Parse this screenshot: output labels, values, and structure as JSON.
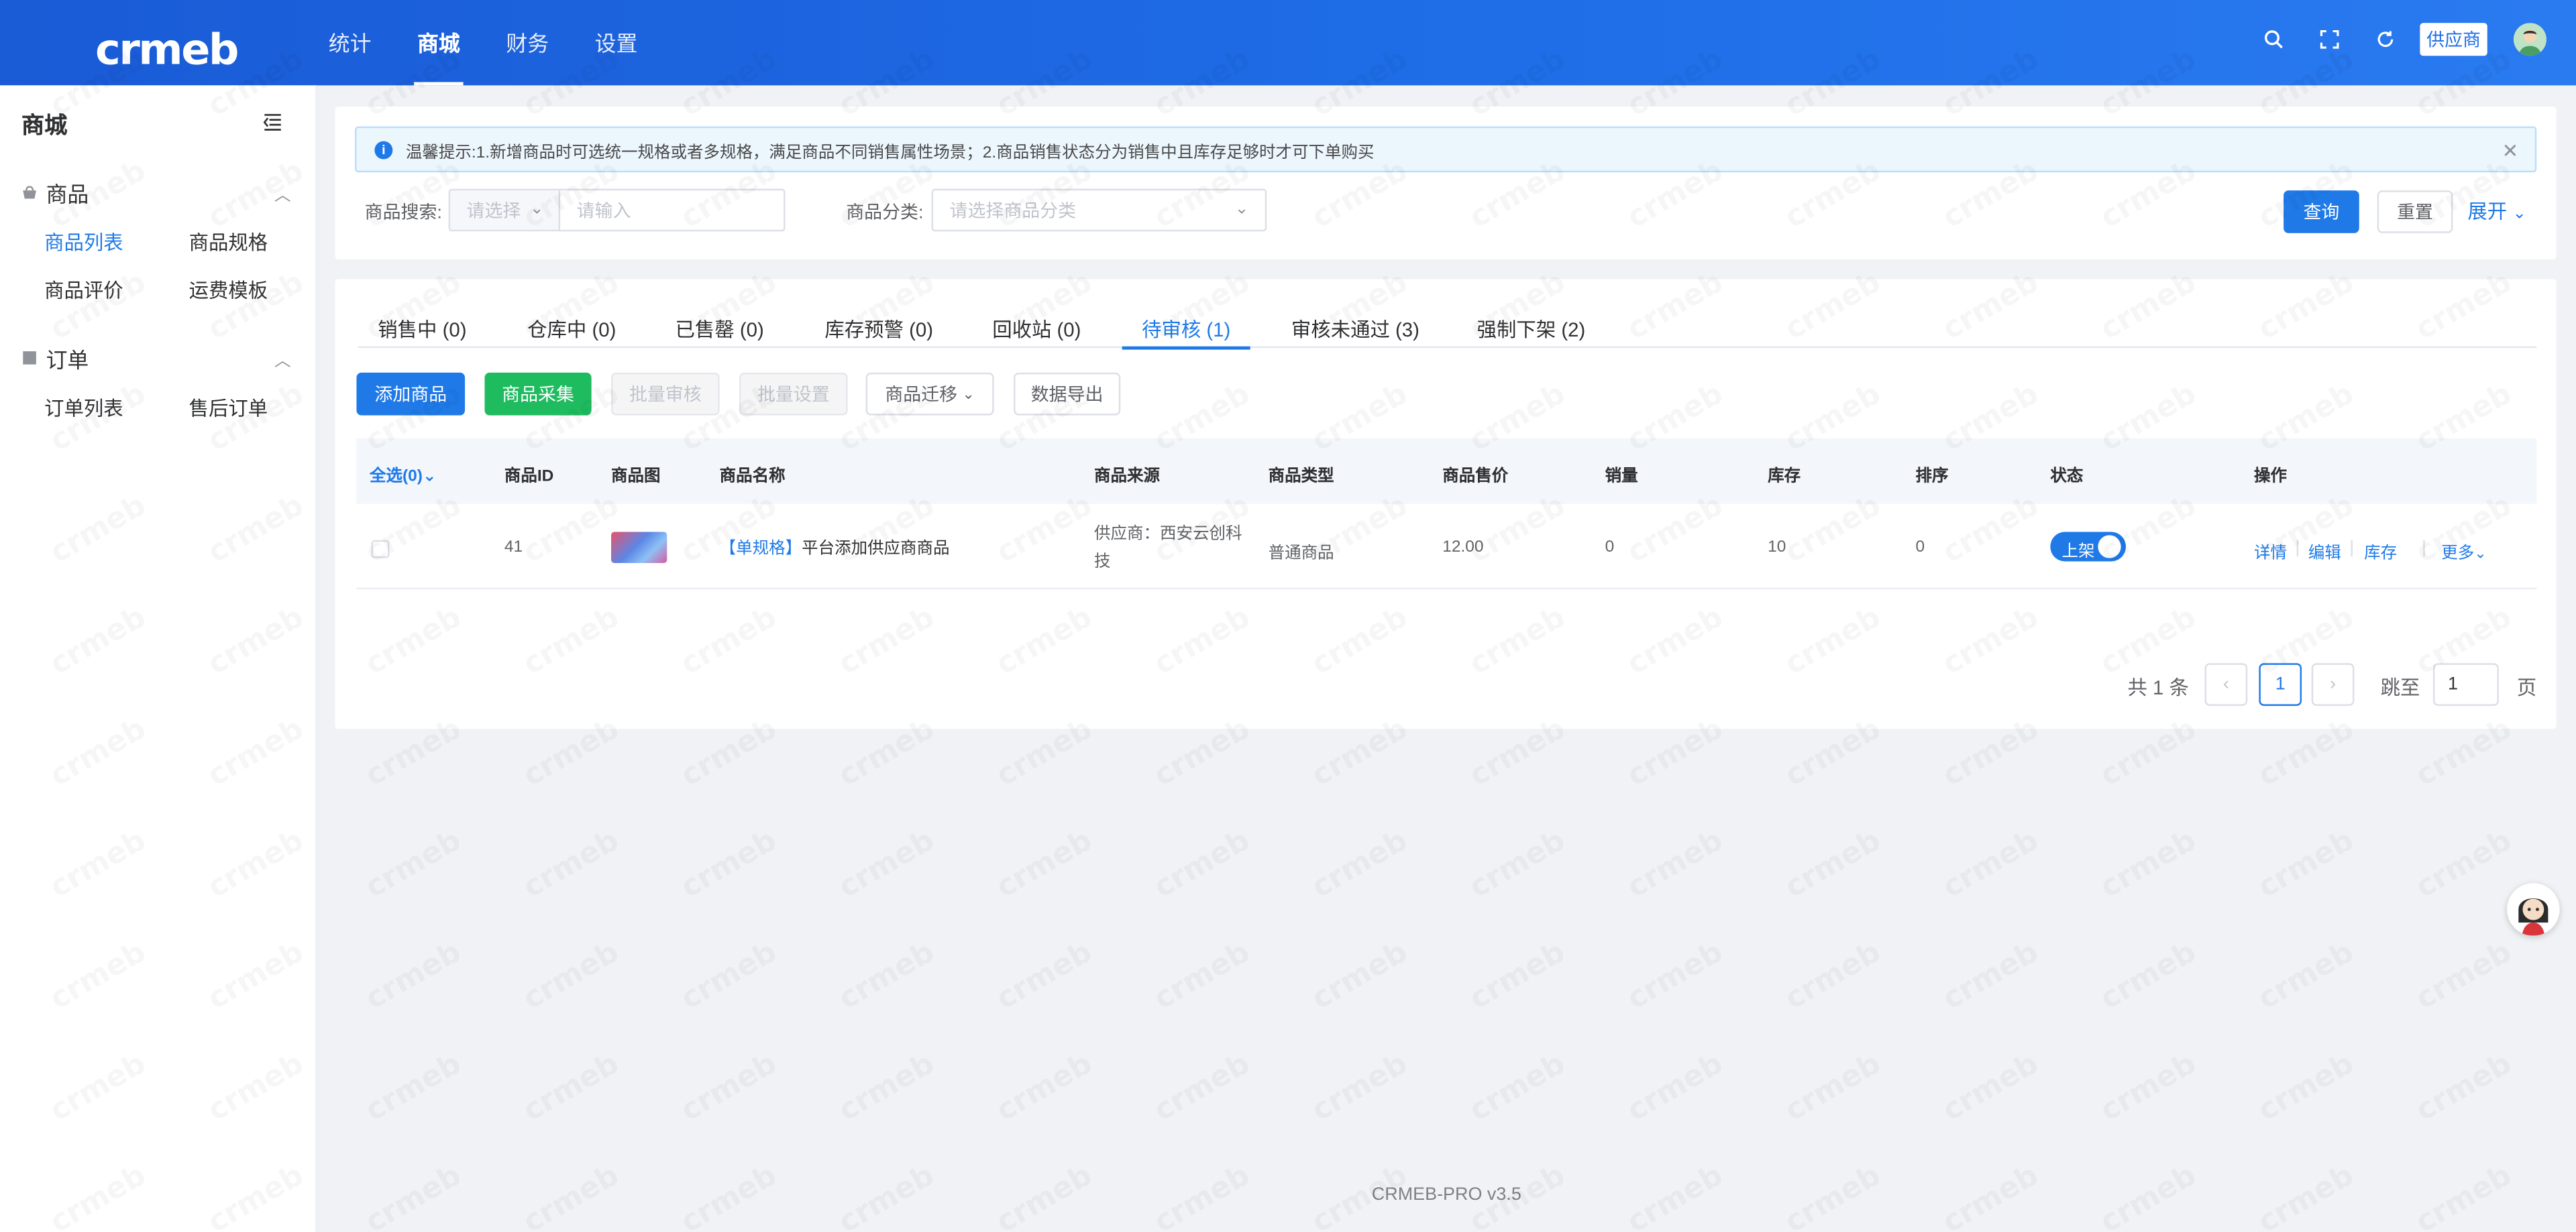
{
  "header": {
    "logo": "crmeb",
    "nav": [
      {
        "label": "统计"
      },
      {
        "label": "商城"
      },
      {
        "label": "财务"
      },
      {
        "label": "设置"
      }
    ],
    "supplier_badge": "供应商"
  },
  "sidebar": {
    "title": "商城",
    "groups": [
      {
        "label": "商品",
        "links": [
          "商品列表",
          "商品规格",
          "商品评价",
          "运费模板"
        ]
      },
      {
        "label": "订单",
        "links": [
          "订单列表",
          "售后订单"
        ]
      }
    ]
  },
  "alert": {
    "text": "温馨提示:1.新增商品时可选统一规格或者多规格，满足商品不同销售属性场景；2.商品销售状态分为销售中且库存足够时才可下单购买"
  },
  "search": {
    "label": "商品搜索:",
    "select_placeholder": "请选择",
    "input_placeholder": "请输入",
    "category_label": "商品分类:",
    "category_placeholder": "请选择商品分类",
    "query_button": "查询",
    "reset_button": "重置",
    "expand_link": "展开"
  },
  "tabs": [
    {
      "label": "销售中 (0)"
    },
    {
      "label": "仓库中 (0)"
    },
    {
      "label": "已售罄 (0)"
    },
    {
      "label": "库存预警 (0)"
    },
    {
      "label": "回收站 (0)"
    },
    {
      "label": "待审核 (1)"
    },
    {
      "label": "审核未通过 (3)"
    },
    {
      "label": "强制下架 (2)"
    }
  ],
  "toolbar": {
    "add": "添加商品",
    "collect": "商品采集",
    "batch_review": "批量审核",
    "batch_set": "批量设置",
    "migrate": "商品迁移",
    "export": "数据导出"
  },
  "table": {
    "select_all": "全选(0)",
    "headers": [
      "商品ID",
      "商品图",
      "商品名称",
      "商品来源",
      "商品类型",
      "商品售价",
      "销量",
      "库存",
      "排序",
      "状态",
      "操作"
    ],
    "rows": [
      {
        "id": "41",
        "name_tag": "【单规格】",
        "name": "平台添加供应商商品",
        "source_line1": "供应商：西安云创科",
        "source_line2": "技",
        "type": "普通商品",
        "price": "12.00",
        "sales": "0",
        "stock": "10",
        "sort": "0",
        "status": "上架",
        "ops": [
          "详情",
          "编辑",
          "库存",
          "更多"
        ]
      }
    ]
  },
  "pagination": {
    "total": "共 1 条",
    "current": "1",
    "jump_label": "跳至",
    "jump_value": "1",
    "page_suffix": "页"
  },
  "footer": "CRMEB-PRO v3.5"
}
